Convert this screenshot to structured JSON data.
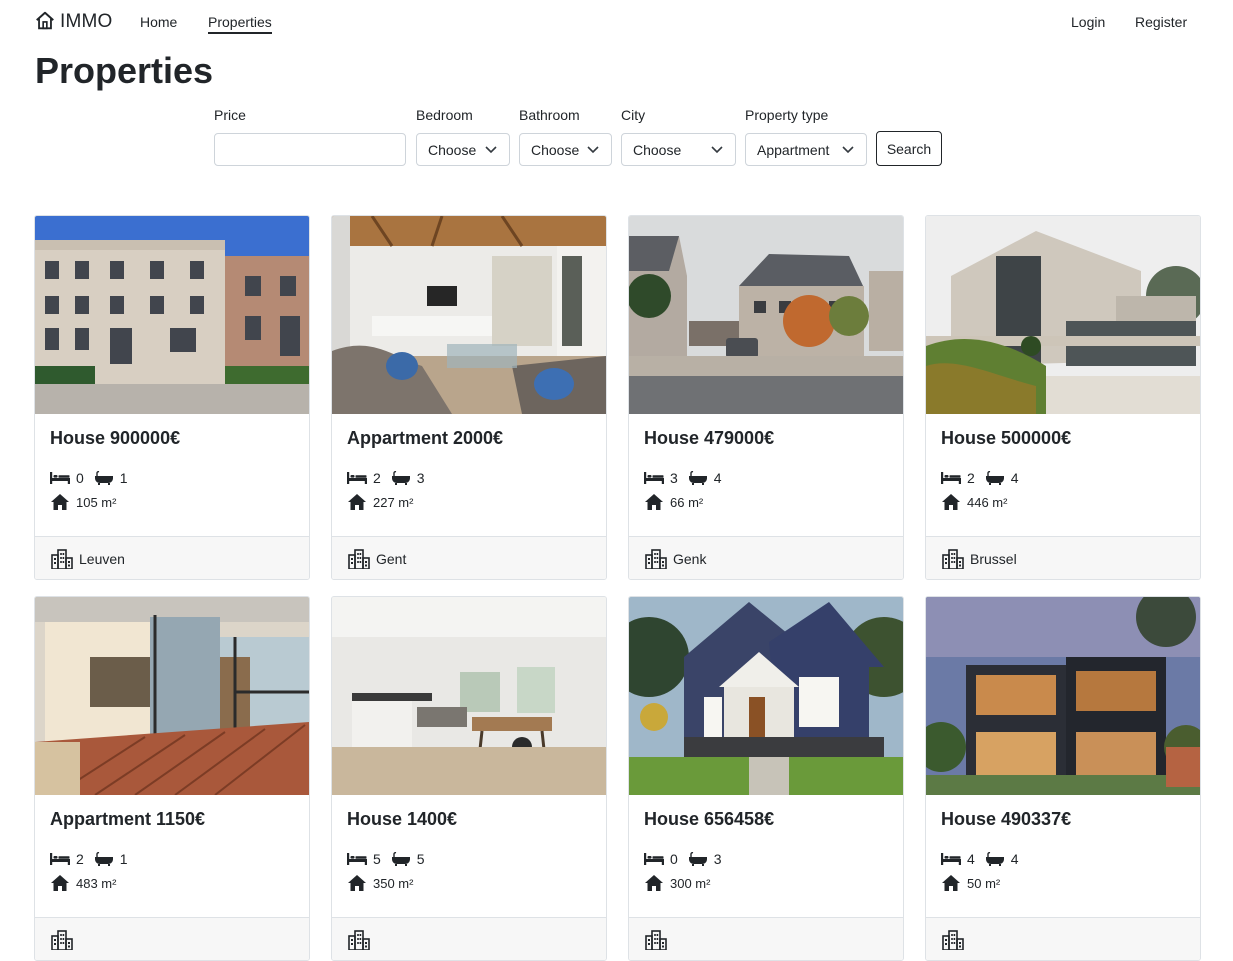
{
  "nav": {
    "brand": "IMMO",
    "links": [
      "Home",
      "Properties"
    ],
    "login": "Login",
    "register": "Register"
  },
  "page": {
    "title": "Properties"
  },
  "filters": {
    "price_label": "Price",
    "price_value": "",
    "bedroom_label": "Bedroom",
    "bedroom_value": "Choose",
    "bathroom_label": "Bathroom",
    "bathroom_value": "Choose",
    "city_label": "City",
    "city_value": "Choose",
    "type_label": "Property type",
    "type_value": "Appartment",
    "search_label": "Search"
  },
  "listings": [
    {
      "title": "House 900000€",
      "bedrooms": "0",
      "bathrooms": "1",
      "area": "105 m²",
      "city": "Leuven"
    },
    {
      "title": "Appartment 2000€",
      "bedrooms": "2",
      "bathrooms": "3",
      "area": "227 m²",
      "city": "Gent"
    },
    {
      "title": "House 479000€",
      "bedrooms": "3",
      "bathrooms": "4",
      "area": "66 m²",
      "city": "Genk"
    },
    {
      "title": "House 500000€",
      "bedrooms": "2",
      "bathrooms": "4",
      "area": "446 m²",
      "city": "Brussel"
    },
    {
      "title": "Appartment 1150€",
      "bedrooms": "2",
      "bathrooms": "1",
      "area": "483 m²",
      "city": ""
    },
    {
      "title": "House 1400€",
      "bedrooms": "5",
      "bathrooms": "5",
      "area": "350 m²",
      "city": ""
    },
    {
      "title": "House 656458€",
      "bedrooms": "0",
      "bathrooms": "3",
      "area": "300 m²",
      "city": ""
    },
    {
      "title": "House 490337€",
      "bedrooms": "4",
      "bathrooms": "4",
      "area": "50 m²",
      "city": ""
    }
  ],
  "icons": {
    "brand": "house-outline-icon",
    "bed": "bed-icon",
    "bath": "bathtub-icon",
    "area": "house-icon",
    "city": "buildings-icon",
    "select": "chevron-down-icon"
  }
}
